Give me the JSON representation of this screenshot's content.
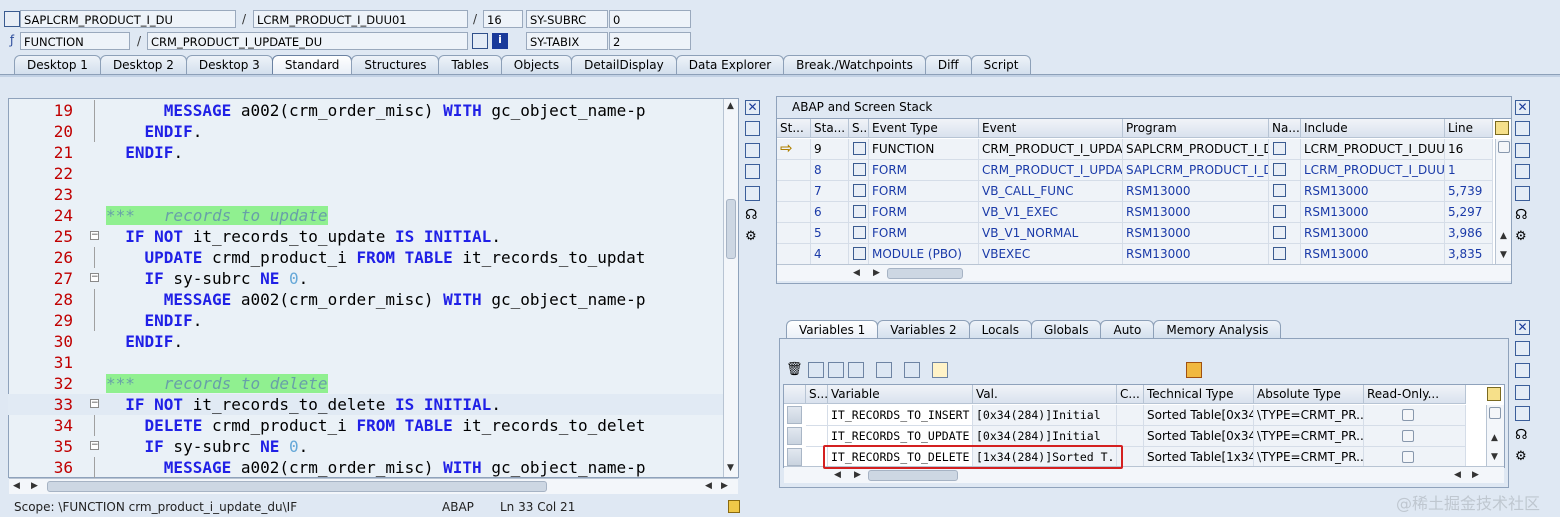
{
  "header": {
    "program": "SAPLCRM_PRODUCT_I_DU",
    "include": "LCRM_PRODUCT_I_DUU01",
    "line": "16",
    "sysubrc_label": "SY-SUBRC",
    "sysubrc_value": "0",
    "event_type": "FUNCTION",
    "event_name": "CRM_PRODUCT_I_UPDATE_DU",
    "sytabix_label": "SY-TABIX",
    "sytabix_value": "2",
    "slash": "/"
  },
  "tabs": [
    "Desktop 1",
    "Desktop 2",
    "Desktop 3",
    "Standard",
    "Structures",
    "Tables",
    "Objects",
    "DetailDisplay",
    "Data Explorer",
    "Break./Watchpoints",
    "Diff",
    "Script"
  ],
  "active_tab": "Standard",
  "editor": {
    "lines": [
      {
        "n": "19",
        "indent": "      ",
        "parts": [
          [
            "kw",
            "MESSAGE"
          ],
          [
            "t",
            " a002"
          ],
          [
            "t",
            "(crm_order_misc) "
          ],
          [
            "kw",
            "WITH"
          ],
          [
            "t",
            " gc_object_name-p"
          ]
        ],
        "fold": "line"
      },
      {
        "n": "20",
        "indent": "    ",
        "parts": [
          [
            "kw",
            "ENDIF"
          ],
          [
            "t",
            "."
          ]
        ],
        "fold": "line"
      },
      {
        "n": "21",
        "indent": "  ",
        "parts": [
          [
            "kw",
            "ENDIF"
          ],
          [
            "t",
            "."
          ]
        ],
        "fold": "none"
      },
      {
        "n": "22",
        "indent": "",
        "parts": [],
        "fold": "none"
      },
      {
        "n": "23",
        "indent": "",
        "parts": [],
        "fold": "none"
      },
      {
        "n": "24",
        "indent": "",
        "parts": [
          [
            "cmb",
            "***   records to update"
          ]
        ],
        "fold": "none"
      },
      {
        "n": "25",
        "indent": "  ",
        "parts": [
          [
            "kw",
            "IF NOT"
          ],
          [
            "t",
            " it_records_to_update "
          ],
          [
            "kw",
            "IS INITIAL"
          ],
          [
            "t",
            "."
          ]
        ],
        "fold": "box"
      },
      {
        "n": "26",
        "indent": "    ",
        "parts": [
          [
            "kw",
            "UPDATE"
          ],
          [
            "t",
            " crmd_product_i "
          ],
          [
            "kw",
            "FROM TABLE"
          ],
          [
            "t",
            " it_records_to_updat"
          ]
        ],
        "fold": "line"
      },
      {
        "n": "27",
        "indent": "    ",
        "parts": [
          [
            "kw",
            "IF"
          ],
          [
            "t",
            " sy-subrc "
          ],
          [
            "kw",
            "NE"
          ],
          [
            "t",
            " "
          ],
          [
            "num",
            "0"
          ],
          [
            "t",
            "."
          ]
        ],
        "fold": "box"
      },
      {
        "n": "28",
        "indent": "      ",
        "parts": [
          [
            "kw",
            "MESSAGE"
          ],
          [
            "t",
            " a002(crm_order_misc) "
          ],
          [
            "kw",
            "WITH"
          ],
          [
            "t",
            " gc_object_name-p"
          ]
        ],
        "fold": "line"
      },
      {
        "n": "29",
        "indent": "    ",
        "parts": [
          [
            "kw",
            "ENDIF"
          ],
          [
            "t",
            "."
          ]
        ],
        "fold": "line"
      },
      {
        "n": "30",
        "indent": "  ",
        "parts": [
          [
            "kw",
            "ENDIF"
          ],
          [
            "t",
            "."
          ]
        ],
        "fold": "none"
      },
      {
        "n": "31",
        "indent": "",
        "parts": [],
        "fold": "none"
      },
      {
        "n": "32",
        "indent": "",
        "parts": [
          [
            "cmb",
            "***   records to delete"
          ]
        ],
        "fold": "none"
      },
      {
        "n": "33",
        "indent": "  ",
        "parts": [
          [
            "kw",
            "IF NOT"
          ],
          [
            "t",
            " it_records_to_delete "
          ],
          [
            "kw",
            "IS INITIAL"
          ],
          [
            "t",
            "."
          ]
        ],
        "fold": "box",
        "highlight": true
      },
      {
        "n": "34",
        "indent": "    ",
        "parts": [
          [
            "kw",
            "DELETE"
          ],
          [
            "t",
            " crmd_product_i "
          ],
          [
            "kw",
            "FROM TABLE"
          ],
          [
            "t",
            " it_records_to_delet"
          ]
        ],
        "fold": "line"
      },
      {
        "n": "35",
        "indent": "    ",
        "parts": [
          [
            "kw",
            "IF"
          ],
          [
            "t",
            " sy-subrc "
          ],
          [
            "kw",
            "NE"
          ],
          [
            "t",
            " "
          ],
          [
            "num",
            "0"
          ],
          [
            "t",
            "."
          ]
        ],
        "fold": "box"
      },
      {
        "n": "36",
        "indent": "      ",
        "parts": [
          [
            "kw",
            "MESSAGE"
          ],
          [
            "t",
            " a002(crm_order_misc) "
          ],
          [
            "kw",
            "WITH"
          ],
          [
            "t",
            " gc_object_name-p"
          ]
        ],
        "fold": "line"
      }
    ]
  },
  "status": {
    "scope": "Scope: \\FUNCTION crm_product_i_update_du\\IF",
    "lang": "ABAP",
    "pos": "Ln  33 Col  21"
  },
  "stack": {
    "title": "ABAP and Screen Stack",
    "columns": [
      "St...",
      "Sta...",
      "S...",
      "Event Type",
      "Event",
      "Program",
      "Na...",
      "Include",
      "Line"
    ],
    "rows": [
      {
        "level": "9",
        "type": "FUNCTION",
        "event": "CRM_PRODUCT_I_UPDA...",
        "program": "SAPLCRM_PRODUCT_I_D...",
        "include": "LCRM_PRODUCT_I_DUU...",
        "line": "16",
        "current": true,
        "link": false
      },
      {
        "level": "8",
        "type": "FORM",
        "event": "CRM_PRODUCT_I_UPDA...",
        "program": "SAPLCRM_PRODUCT_I_D...",
        "include": "LCRM_PRODUCT_I_DUU...",
        "line": "1",
        "current": false,
        "link": true
      },
      {
        "level": "7",
        "type": "FORM",
        "event": "VB_CALL_FUNC",
        "program": "RSM13000",
        "include": "RSM13000",
        "line": "5,739",
        "current": false,
        "link": true
      },
      {
        "level": "6",
        "type": "FORM",
        "event": "VB_V1_EXEC",
        "program": "RSM13000",
        "include": "RSM13000",
        "line": "5,297",
        "current": false,
        "link": true
      },
      {
        "level": "5",
        "type": "FORM",
        "event": "VB_V1_NORMAL",
        "program": "RSM13000",
        "include": "RSM13000",
        "line": "3,986",
        "current": false,
        "link": true
      },
      {
        "level": "4",
        "type": "MODULE (PBO)",
        "event": "VBEXEC",
        "program": "RSM13000",
        "include": "RSM13000",
        "line": "3,835",
        "current": false,
        "link": true
      }
    ]
  },
  "vars": {
    "tabs": [
      "Variables 1",
      "Variables 2",
      "Locals",
      "Globals",
      "Auto",
      "Memory Analysis"
    ],
    "active": "Variables 1",
    "columns": [
      "S...",
      "Variable",
      "Val.",
      "C...",
      "Technical Type",
      "Absolute Type",
      "Read-Only..."
    ],
    "rows": [
      {
        "name": "IT_RECORDS_TO_INSERT",
        "val": "[0x34(284)]Initial ",
        "tech": "Sorted Table[0x34...",
        "abs": "\\TYPE=CRMT_PR..."
      },
      {
        "name": "IT_RECORDS_TO_UPDATE",
        "val": "[0x34(284)]Initial ",
        "tech": "Sorted Table[0x34...",
        "abs": "\\TYPE=CRMT_PR..."
      },
      {
        "name": "IT_RECORDS_TO_DELETE",
        "val": "[1x34(284)]Sorted T...",
        "tech": "Sorted Table[1x34...",
        "abs": "\\TYPE=CRMT_PR..."
      }
    ]
  },
  "watermark": "@稀土掘金技术社区"
}
